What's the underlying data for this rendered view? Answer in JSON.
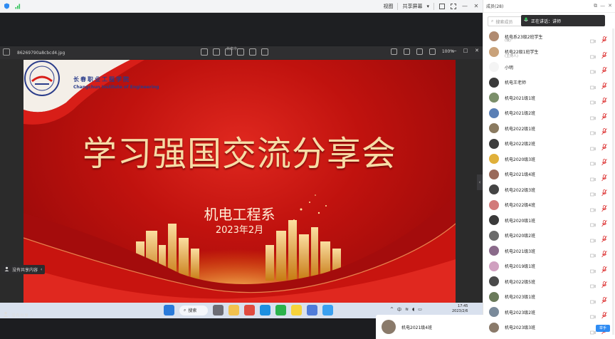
{
  "topbar": {
    "left_icons": [
      "shield-icon",
      "signal-icon"
    ],
    "view_label": "视图",
    "share_label": "共享屏幕",
    "share_sub": "▾"
  },
  "viewer": {
    "filename": "86269790a8cbcd4.jpg",
    "caption": "共享中",
    "zoom": "100%"
  },
  "slide": {
    "logo_cn": "长春职业工程学院",
    "logo_en": "Changchun Institute of Engineering",
    "title": "学习强国交流分享会",
    "department": "机电工程系",
    "date": "2023年2月"
  },
  "taskbar": {
    "search_label": "搜索",
    "lang": "中",
    "time": "17:45",
    "date": "2023/2/6"
  },
  "mini_share": {
    "label": "没有共享内容"
  },
  "bottom_left": {
    "label": "没有共享"
  },
  "panel": {
    "header": "成员(28)",
    "search_placeholder": "搜索成员",
    "speaker": "正在讲话：讲师",
    "participants": [
      {
        "name": "机电系23级2班学生",
        "sub": "(我)",
        "color": "#b08a70"
      },
      {
        "name": "机电22级1班学生",
        "sub": "(主持人)",
        "color": "#c9a27a"
      },
      {
        "name": "小明",
        "sub": "",
        "color": "#f4f4f4"
      },
      {
        "name": "机电王老师",
        "sub": "",
        "color": "#3a3a3a"
      },
      {
        "name": "机电2021级1班",
        "sub": "",
        "color": "#7b8f6a"
      },
      {
        "name": "机电2021级2班",
        "sub": "",
        "color": "#5a7fb5"
      },
      {
        "name": "机电2022级1班",
        "sub": "",
        "color": "#8a7a60"
      },
      {
        "name": "机电2022级2班",
        "sub": "",
        "color": "#3d3d3d"
      },
      {
        "name": "机电2020级3班",
        "sub": "",
        "color": "#e0b03a"
      },
      {
        "name": "机电2021级4班",
        "sub": "",
        "color": "#9a6a5a"
      },
      {
        "name": "机电2022级3班",
        "sub": "",
        "color": "#444444"
      },
      {
        "name": "机电2022级4班",
        "sub": "",
        "color": "#d27a7a"
      },
      {
        "name": "机电2020级1班",
        "sub": "",
        "color": "#3a3a3a"
      },
      {
        "name": "机电2020级2班",
        "sub": "",
        "color": "#6a6a6a"
      },
      {
        "name": "机电2021级3班",
        "sub": "",
        "color": "#8a6a8a"
      },
      {
        "name": "机电2019级1班",
        "sub": "",
        "color": "#d0a0c0"
      },
      {
        "name": "机电2022级5班",
        "sub": "",
        "color": "#4a4a4a"
      },
      {
        "name": "机电2023级1班",
        "sub": "",
        "color": "#6a7a5a"
      },
      {
        "name": "机电2023级2班",
        "sub": "",
        "color": "#7a8a9a"
      },
      {
        "name": "机电2023级3班",
        "sub": "",
        "color": "#8a7a6a"
      }
    ]
  },
  "selfcard": {
    "name": "机电2021级4班",
    "hand_label": "举手"
  },
  "colors": {
    "accent": "#2f8cf3",
    "live_green": "#32c45a",
    "slide_red": "#c0120e"
  }
}
